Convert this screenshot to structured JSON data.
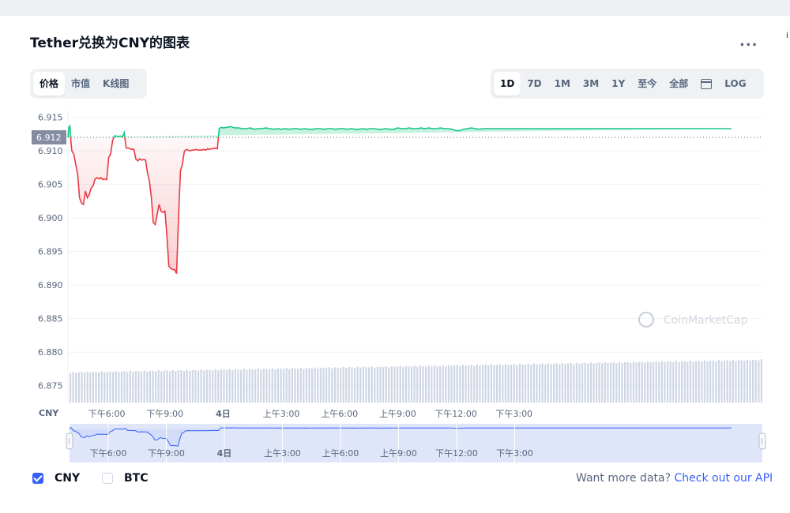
{
  "title": "Tether兑换为CNY的图表",
  "more_menu": "...",
  "edge_glyph": "i",
  "view_tabs": [
    {
      "label": "价格",
      "active": true
    },
    {
      "label": "市值",
      "active": false
    },
    {
      "label": "K线图",
      "active": false
    }
  ],
  "range_tabs": [
    {
      "label": "1D",
      "active": true
    },
    {
      "label": "7D",
      "active": false
    },
    {
      "label": "1M",
      "active": false
    },
    {
      "label": "3M",
      "active": false
    },
    {
      "label": "1Y",
      "active": false
    },
    {
      "label": "至今",
      "active": false
    },
    {
      "label": "全部",
      "active": false
    }
  ],
  "calendar_icon": "calendar-icon",
  "log_label": "LOG",
  "colors": {
    "up": "#16c784",
    "down": "#ea3943",
    "accent": "#3861fb",
    "volume": "#cfd6e4",
    "grid": "#eff2f5"
  },
  "chart_data": {
    "type": "line",
    "title": "",
    "xlabel": "",
    "ylabel": "",
    "y_unit_label": "CNY",
    "ylim": [
      6.8725,
      6.916
    ],
    "y_ticks": [
      6.915,
      6.91,
      6.905,
      6.9,
      6.895,
      6.89,
      6.885,
      6.88,
      6.875
    ],
    "y_tick_labels": [
      "6.915",
      "6.910",
      "6.905",
      "6.900",
      "6.895",
      "6.890",
      "6.885",
      "6.880",
      "6.875"
    ],
    "x_ticks": [
      {
        "x": 2.0,
        "label": "下午6:00"
      },
      {
        "x": 5.0,
        "label": "下午9:00"
      },
      {
        "x": 8.0,
        "label": "4日"
      },
      {
        "x": 11.0,
        "label": "上午3:00"
      },
      {
        "x": 14.0,
        "label": "上午6:00"
      },
      {
        "x": 17.0,
        "label": "上午9:00"
      },
      {
        "x": 20.0,
        "label": "下午12:00"
      },
      {
        "x": 23.0,
        "label": "下午3:00"
      }
    ],
    "baseline": 6.912,
    "baseline_label": "6.912",
    "grid": true,
    "watermark": "CoinMarketCap",
    "x": [
      0.0,
      0.05,
      0.1,
      0.15,
      0.2,
      0.3,
      0.4,
      0.5,
      0.6,
      0.7,
      0.8,
      0.9,
      1.0,
      1.1,
      1.2,
      1.3,
      1.4,
      1.5,
      1.6,
      1.7,
      1.8,
      1.9,
      2.0,
      2.1,
      2.2,
      2.3,
      2.4,
      2.5,
      2.6,
      2.7,
      2.8,
      2.9,
      3.0,
      3.1,
      3.2,
      3.3,
      3.4,
      3.5,
      3.6,
      3.7,
      3.8,
      3.9,
      4.0,
      4.1,
      4.2,
      4.3,
      4.4,
      4.5,
      4.6,
      4.7,
      4.8,
      4.9,
      5.0,
      5.1,
      5.2,
      5.3,
      5.4,
      5.5,
      5.6,
      5.7,
      5.8,
      5.9,
      6.0,
      6.1,
      6.2,
      6.3,
      6.4,
      6.5,
      6.6,
      6.7,
      6.8,
      6.9,
      7.0,
      7.1,
      7.2,
      7.3,
      7.4,
      7.5,
      7.6,
      7.7,
      7.8,
      7.9,
      8.0,
      8.2,
      8.4,
      8.6,
      8.8,
      9.0,
      9.2,
      9.4,
      9.6,
      9.8,
      10.0,
      10.2,
      10.4,
      10.6,
      10.8,
      11.0,
      11.2,
      11.4,
      11.6,
      11.8,
      12.0,
      12.2,
      12.4,
      12.6,
      12.8,
      13.0,
      13.2,
      13.4,
      13.6,
      13.8,
      14.0,
      14.2,
      14.4,
      14.6,
      14.8,
      15.0,
      15.2,
      15.4,
      15.6,
      15.8,
      16.0,
      16.2,
      16.4,
      16.6,
      16.8,
      17.0,
      17.2,
      17.4,
      17.6,
      17.8,
      18.0,
      18.2,
      18.4,
      18.6,
      18.8,
      19.0,
      19.2,
      19.4,
      19.6,
      19.8,
      20.0,
      20.2,
      20.4,
      20.6,
      20.8,
      21.0,
      21.2,
      21.4,
      21.6,
      21.8,
      22.0,
      22.2,
      22.4,
      22.6,
      22.8,
      23.0,
      23.2,
      23.4,
      23.6,
      23.8,
      24.0,
      24.2,
      24.4,
      24.6,
      24.8,
      25.0,
      25.2,
      25.4,
      25.6,
      25.8,
      26.0,
      26.2,
      26.4,
      26.6,
      26.8,
      27.0,
      27.2,
      27.4,
      27.6,
      27.8,
      28.0,
      28.2,
      28.4,
      28.6,
      28.8,
      29.0,
      29.2,
      29.4,
      29.6,
      29.8,
      30.0,
      30.2,
      30.4,
      30.6,
      30.8,
      31.0,
      31.2,
      31.4,
      31.6,
      31.8,
      32.0,
      32.2,
      32.4,
      32.6,
      32.8,
      33.0,
      33.2,
      33.4,
      33.6,
      33.8,
      34.0,
      34.2,
      34.4,
      34.6,
      34.8,
      35.0,
      35.2,
      35.4,
      35.6,
      35.8
    ],
    "series": [
      {
        "values": [
          6.912,
          6.9135,
          6.9137,
          6.9115,
          6.91,
          6.9095,
          6.908,
          6.9065,
          6.903,
          6.9022,
          6.902,
          6.904,
          6.903,
          6.9035,
          6.9045,
          6.9048,
          6.9058,
          6.906,
          6.9058,
          6.906,
          6.9057,
          6.9058,
          6.9057,
          6.909,
          6.9095,
          6.9115,
          6.9122,
          6.9122,
          6.9121,
          6.9122,
          6.912,
          6.9127,
          6.9104,
          6.9104,
          6.9103,
          6.9102,
          6.9102,
          6.9088,
          6.9085,
          6.9088,
          6.9086,
          6.9087,
          6.9086,
          6.9067,
          6.9055,
          6.903,
          6.8993,
          6.899,
          6.9005,
          6.902,
          6.901,
          6.9008,
          6.901,
          6.8975,
          6.8928,
          6.8925,
          6.8923,
          6.8923,
          6.8917,
          6.9,
          6.907,
          6.908,
          6.9099,
          6.9102,
          6.9101,
          6.91,
          6.9101,
          6.9101,
          6.9102,
          6.9101,
          6.9101,
          6.9101,
          6.9102,
          6.9101,
          6.9103,
          6.9102,
          6.9103,
          6.9103,
          6.9104,
          6.9103,
          6.9133,
          6.9135,
          6.9134,
          6.9135,
          6.9136,
          6.9134,
          6.9134,
          6.9133,
          6.9133,
          6.9134,
          6.9132,
          6.9133,
          6.9133,
          6.9134,
          6.9133,
          6.9132,
          6.9133,
          6.9132,
          6.9133,
          6.9132,
          6.9133,
          6.9133,
          6.9132,
          6.9133,
          6.9132,
          6.9132,
          6.9133,
          6.9133,
          6.9132,
          6.9133,
          6.9133,
          6.9132,
          6.9133,
          6.9133,
          6.9132,
          6.9133,
          6.9132,
          6.9132,
          6.9133,
          6.9132,
          6.9133,
          6.9133,
          6.9132,
          6.9132,
          6.9133,
          6.9132,
          6.9132,
          6.9134,
          6.9133,
          6.9133,
          6.9134,
          6.9133,
          6.9133,
          6.9134,
          6.9133,
          6.9134,
          6.9133,
          6.9133,
          6.9134,
          6.9133,
          6.9133,
          6.9132,
          6.913,
          6.913,
          6.9132,
          6.9133,
          6.9134,
          6.9133,
          6.9132,
          6.9133,
          6.9133,
          6.9133,
          6.9133,
          6.9133,
          6.9133,
          6.9133,
          6.9133,
          6.9133,
          6.9133,
          6.9133,
          6.9133,
          6.9133,
          6.9133,
          6.9133,
          6.9133,
          6.9133,
          6.9133,
          6.9133,
          6.9133,
          6.9133,
          6.9133,
          6.9133,
          6.9133,
          6.9133,
          6.9133,
          6.9133,
          6.9133,
          6.9133,
          6.9133,
          6.9133,
          6.9133,
          6.9133,
          6.9133,
          6.9133,
          6.9133,
          6.9133,
          6.9133,
          6.9133,
          6.9133,
          6.9133,
          6.9133,
          6.9133,
          6.9133,
          6.9133,
          6.9133,
          6.9133,
          6.9133,
          6.9133,
          6.9133,
          6.9133,
          6.9133,
          6.9133,
          6.9133,
          6.9133,
          6.9133,
          6.9133,
          6.9133,
          6.9133,
          6.9133,
          6.9133,
          6.9133,
          6.9133,
          6.9133,
          6.9133
        ]
      }
    ]
  },
  "legend": [
    {
      "label": "CNY",
      "checked": true
    },
    {
      "label": "BTC",
      "checked": false
    }
  ],
  "footer": {
    "text": "Want more data?",
    "link": "Check out our API"
  }
}
